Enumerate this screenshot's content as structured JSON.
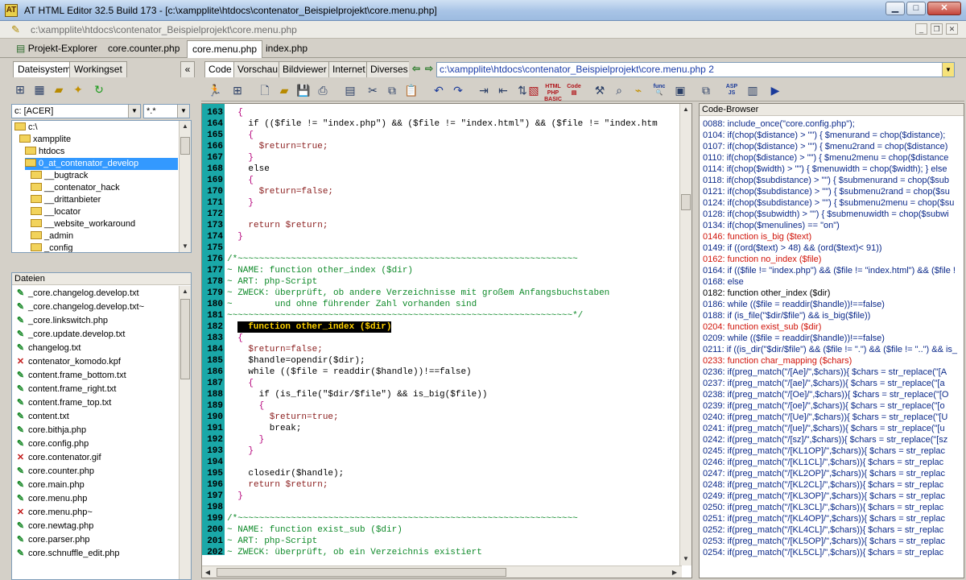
{
  "window": {
    "title": "AT HTML Editor 32.5 Build 173 - [c:\\xampplite\\htdocs\\contenator_Beispielprojekt\\core.menu.php]",
    "minimize": "▁",
    "maximize": "□",
    "close": "✕"
  },
  "doc_path": "c:\\xampplite\\htdocs\\contenator_Beispielprojekt\\core.menu.php",
  "file_tabs": [
    "Projekt-Explorer",
    "core.counter.php",
    "core.menu.php",
    "index.php"
  ],
  "left_tabs": [
    "Dateisystem",
    "Workingset"
  ],
  "drive_combo": "c: [ACER]",
  "filter_combo": "*.*",
  "folder_tree": [
    "c:\\",
    "xampplite",
    "htdocs",
    "0_at_contenator_develop",
    "__bugtrack",
    "__contenator_hack",
    "__drittanbieter",
    "__locator",
    "__website_workaround",
    "_admin",
    "_config"
  ],
  "files_header": "Dateien",
  "files": [
    {
      "name": "_core.changelog.develop.txt",
      "status": "ok"
    },
    {
      "name": "_core.changelog.develop.txt~",
      "status": "ok"
    },
    {
      "name": "_core.linkswitch.php",
      "status": "ok"
    },
    {
      "name": "_core.update.develop.txt",
      "status": "ok"
    },
    {
      "name": "changelog.txt",
      "status": "ok"
    },
    {
      "name": "contenator_komodo.kpf",
      "status": "x"
    },
    {
      "name": "content.frame_bottom.txt",
      "status": "ok"
    },
    {
      "name": "content.frame_right.txt",
      "status": "ok"
    },
    {
      "name": "content.frame_top.txt",
      "status": "ok"
    },
    {
      "name": "content.txt",
      "status": "ok"
    },
    {
      "name": "core.bithja.php",
      "status": "ok"
    },
    {
      "name": "core.config.php",
      "status": "ok"
    },
    {
      "name": "core.contenator.gif",
      "status": "x"
    },
    {
      "name": "core.counter.php",
      "status": "ok"
    },
    {
      "name": "core.main.php",
      "status": "ok"
    },
    {
      "name": "core.menu.php",
      "status": "ok"
    },
    {
      "name": "core.menu.php~",
      "status": "x"
    },
    {
      "name": "core.newtag.php",
      "status": "ok"
    },
    {
      "name": "core.parser.php",
      "status": "ok"
    },
    {
      "name": "core.schnuffle_edit.php",
      "status": "ok"
    }
  ],
  "content_tabs": [
    "Code",
    "Vorschau",
    "Bildviewer",
    "Internet",
    "Diverses"
  ],
  "path_combo": "c:\\xampplite\\htdocs\\contenator_Beispielprojekt\\core.menu.php 2",
  "code_lines": [
    {
      "n": "163",
      "t": "  {",
      "c": "#b4007a"
    },
    {
      "n": "164",
      "t": "    if (($file != \"index.php\") && ($file != \"index.html\") && ($file != \"index.htm",
      "c": "#000"
    },
    {
      "n": "165",
      "t": "    {",
      "c": "#b4007a"
    },
    {
      "n": "166",
      "t": "      $return=true;",
      "c": "#8a1c1c"
    },
    {
      "n": "167",
      "t": "    }",
      "c": "#b4007a"
    },
    {
      "n": "168",
      "t": "    else",
      "c": "#000"
    },
    {
      "n": "169",
      "t": "    {",
      "c": "#b4007a"
    },
    {
      "n": "170",
      "t": "      $return=false;",
      "c": "#8a1c1c"
    },
    {
      "n": "171",
      "t": "    }",
      "c": "#b4007a"
    },
    {
      "n": "172",
      "t": "",
      "c": "#000"
    },
    {
      "n": "173",
      "t": "    return $return;",
      "c": "#8a1c1c"
    },
    {
      "n": "174",
      "t": "  }",
      "c": "#b4007a"
    },
    {
      "n": "175",
      "t": "",
      "c": "#000"
    },
    {
      "n": "176",
      "t": "/*~~~~~~~~~~~~~~~~~~~~~~~~~~~~~~~~~~~~~~~~~~~~~~~~~~~~~~~~~~~~~~~~",
      "c": "#0f8a2a"
    },
    {
      "n": "177",
      "t": "~ NAME: function other_index ($dir)",
      "c": "#0f8a2a"
    },
    {
      "n": "178",
      "t": "~ ART: php-Script",
      "c": "#0f8a2a"
    },
    {
      "n": "179",
      "t": "~ ZWECK: überprüft, ob andere Verzeichnisse mit großem Anfangsbuchstaben",
      "c": "#0f8a2a"
    },
    {
      "n": "180",
      "t": "~        und ohne führender Zahl vorhanden sind",
      "c": "#0f8a2a"
    },
    {
      "n": "181",
      "t": "~~~~~~~~~~~~~~~~~~~~~~~~~~~~~~~~~~~~~~~~~~~~~~~~~~~~~~~~~~~~~~~~~*/",
      "c": "#0f8a2a"
    },
    {
      "n": "182",
      "t": "  function other_index ($dir)",
      "c": "#fff",
      "hl": true
    },
    {
      "n": "183",
      "t": "  {",
      "c": "#b4007a"
    },
    {
      "n": "184",
      "t": "    $return=false;",
      "c": "#8a1c1c"
    },
    {
      "n": "185",
      "t": "    $handle=opendir($dir);",
      "c": "#000"
    },
    {
      "n": "186",
      "t": "    while (($file = readdir($handle))!==false)",
      "c": "#000"
    },
    {
      "n": "187",
      "t": "    {",
      "c": "#b4007a"
    },
    {
      "n": "188",
      "t": "      if (is_file(\"$dir/$file\") && is_big($file))",
      "c": "#000"
    },
    {
      "n": "189",
      "t": "      {",
      "c": "#b4007a"
    },
    {
      "n": "190",
      "t": "        $return=true;",
      "c": "#8a1c1c"
    },
    {
      "n": "191",
      "t": "        break;",
      "c": "#000"
    },
    {
      "n": "192",
      "t": "      }",
      "c": "#b4007a"
    },
    {
      "n": "193",
      "t": "    }",
      "c": "#b4007a"
    },
    {
      "n": "194",
      "t": "",
      "c": "#000"
    },
    {
      "n": "195",
      "t": "    closedir($handle);",
      "c": "#000"
    },
    {
      "n": "196",
      "t": "    return $return;",
      "c": "#8a1c1c"
    },
    {
      "n": "197",
      "t": "  }",
      "c": "#b4007a"
    },
    {
      "n": "198",
      "t": "",
      "c": "#000"
    },
    {
      "n": "199",
      "t": "/*~~~~~~~~~~~~~~~~~~~~~~~~~~~~~~~~~~~~~~~~~~~~~~~~~~~~~~~~~~~~~~~~",
      "c": "#0f8a2a"
    },
    {
      "n": "200",
      "t": "~ NAME: function exist_sub ($dir)",
      "c": "#0f8a2a"
    },
    {
      "n": "201",
      "t": "~ ART: php-Script",
      "c": "#0f8a2a"
    },
    {
      "n": "202",
      "t": "~ ZWECK: überprüft, ob ein Verzeichnis existiert",
      "c": "#0f8a2a"
    }
  ],
  "code_browser_header": "Code-Browser",
  "code_browser": [
    {
      "t": "0088: include_once(\"core.config.php\");",
      "s": "b"
    },
    {
      "t": "0104: if(chop($distance) > \"\") { $menurand = chop($distance);",
      "s": "b"
    },
    {
      "t": "0107: if(chop($distance) > \"\") { $menu2rand = chop($distance)",
      "s": "b"
    },
    {
      "t": "0110: if(chop($distance) > \"\") { $menu2menu = chop($distance",
      "s": "b"
    },
    {
      "t": "0114: if(chop($width) > \"\") { $menuwidth = chop($width); } else",
      "s": "b"
    },
    {
      "t": "0118: if(chop($subdistance) > \"\") { $submenurand = chop($sub",
      "s": "b"
    },
    {
      "t": "0121: if(chop($subdistance) > \"\") { $submenu2rand = chop($su",
      "s": "b"
    },
    {
      "t": "0124: if(chop($subdistance) > \"\") { $submenu2menu = chop($su",
      "s": "b"
    },
    {
      "t": "0128: if(chop($subwidth) > \"\") { $submenuwidth = chop($subwi",
      "s": "b"
    },
    {
      "t": "0134: if(chop($menulines) == \"on\")",
      "s": "b"
    },
    {
      "t": "0146: function is_big ($text)",
      "s": "r"
    },
    {
      "t": "0149: if ((ord($text) > 48) && (ord($text)< 91))",
      "s": "b"
    },
    {
      "t": "0162: function no_index ($file)",
      "s": "r"
    },
    {
      "t": "0164: if (($file != \"index.php\") && ($file != \"index.html\") && ($file !",
      "s": "b"
    },
    {
      "t": "0168: else",
      "s": "b"
    },
    {
      "t": "0182: function other_index ($dir)",
      "s": "k"
    },
    {
      "t": "0186: while (($file = readdir($handle))!==false)",
      "s": "b"
    },
    {
      "t": "0188: if (is_file(\"$dir/$file\") && is_big($file))",
      "s": "b"
    },
    {
      "t": "0204: function exist_sub ($dir)",
      "s": "r"
    },
    {
      "t": "0209: while (($file = readdir($handle))!==false)",
      "s": "b"
    },
    {
      "t": "0211: if ((is_dir(\"$dir/$file\") && ($file != \".\") && ($file != \"..\") && is_",
      "s": "b"
    },
    {
      "t": "0233: function char_mapping ($chars)",
      "s": "r"
    },
    {
      "t": "0236: if(preg_match(\"/[Ae]/\",$chars)){ $chars = str_replace(\"[A",
      "s": "b"
    },
    {
      "t": "0237: if(preg_match(\"/[ae]/\",$chars)){ $chars = str_replace(\"[a",
      "s": "b"
    },
    {
      "t": "0238: if(preg_match(\"/[Oe]/\",$chars)){ $chars = str_replace(\"[O",
      "s": "b"
    },
    {
      "t": "0239: if(preg_match(\"/[oe]/\",$chars)){ $chars = str_replace(\"[o",
      "s": "b"
    },
    {
      "t": "0240: if(preg_match(\"/[Ue]/\",$chars)){ $chars = str_replace(\"[U",
      "s": "b"
    },
    {
      "t": "0241: if(preg_match(\"/[ue]/\",$chars)){ $chars = str_replace(\"[u",
      "s": "b"
    },
    {
      "t": "0242: if(preg_match(\"/[sz]/\",$chars)){ $chars = str_replace(\"[sz",
      "s": "b"
    },
    {
      "t": "0245: if(preg_match(\"/[KL1OP]/\",$chars)){ $chars = str_replac",
      "s": "b"
    },
    {
      "t": "0246: if(preg_match(\"/[KL1CL]/\",$chars)){ $chars = str_replac",
      "s": "b"
    },
    {
      "t": "0247: if(preg_match(\"/[KL2OP]/\",$chars)){ $chars = str_replac",
      "s": "b"
    },
    {
      "t": "0248: if(preg_match(\"/[KL2CL]/\",$chars)){ $chars = str_replac",
      "s": "b"
    },
    {
      "t": "0249: if(preg_match(\"/[KL3OP]/\",$chars)){ $chars = str_replac",
      "s": "b"
    },
    {
      "t": "0250: if(preg_match(\"/[KL3CL]/\",$chars)){ $chars = str_replac",
      "s": "b"
    },
    {
      "t": "0251: if(preg_match(\"/[KL4OP]/\",$chars)){ $chars = str_replac",
      "s": "b"
    },
    {
      "t": "0252: if(preg_match(\"/[KL4CL]/\",$chars)){ $chars = str_replac",
      "s": "b"
    },
    {
      "t": "0253: if(preg_match(\"/[KL5OP]/\",$chars)){ $chars = str_replac",
      "s": "b"
    },
    {
      "t": "0254: if(preg_match(\"/[KL5CL]/\",$chars)){ $chars = str_replac",
      "s": "b"
    }
  ],
  "colors": {
    "gutter": "#1aa8a8",
    "selection": "#3399ff",
    "highlight_bg": "#000000",
    "highlight_fg": "#ffd200"
  }
}
